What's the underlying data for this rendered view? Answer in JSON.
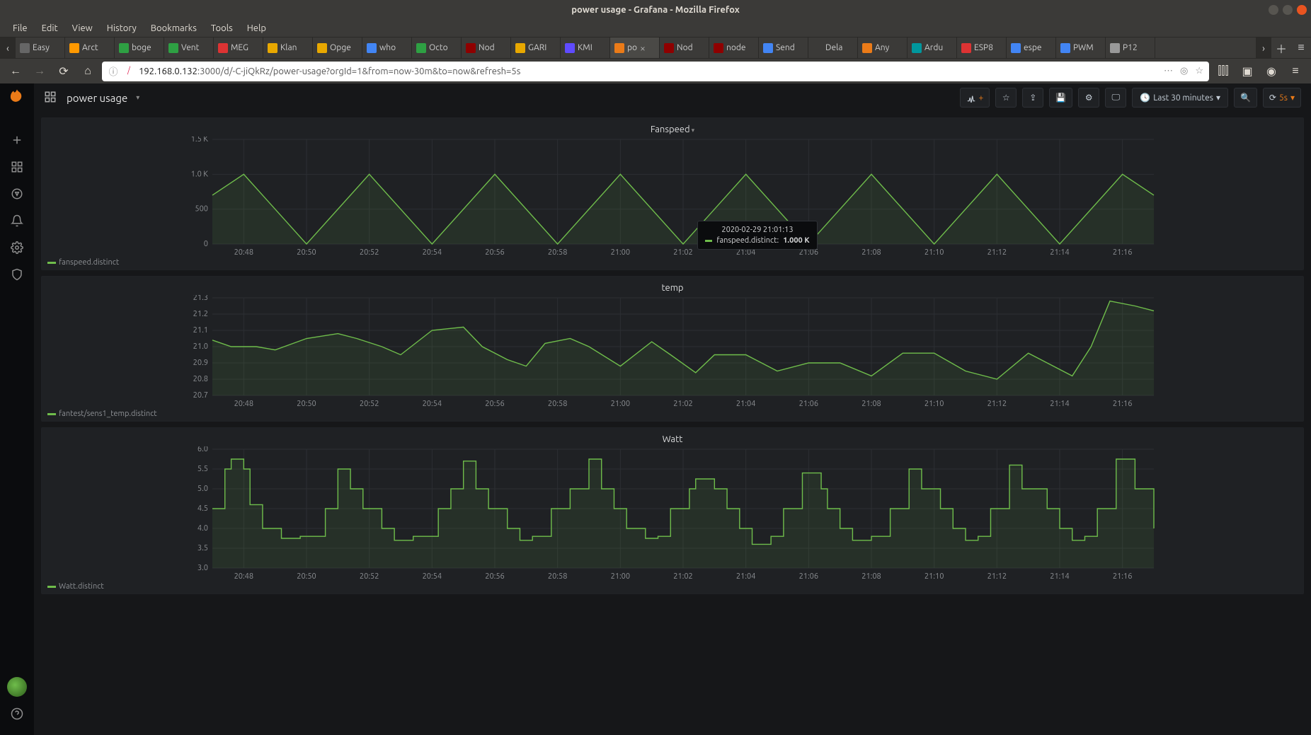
{
  "window": {
    "title": "power usage - Grafana - Mozilla Firefox"
  },
  "menubar": [
    "File",
    "Edit",
    "View",
    "History",
    "Bookmarks",
    "Tools",
    "Help"
  ],
  "tabs": [
    {
      "label": "Easy",
      "fav": "#666"
    },
    {
      "label": "Arct",
      "fav": "#ff9900"
    },
    {
      "label": "boge",
      "fav": "#2ea043"
    },
    {
      "label": "Vent",
      "fav": "#2ea043"
    },
    {
      "label": "MEG",
      "fav": "#d33"
    },
    {
      "label": "Klan",
      "fav": "#e8a800"
    },
    {
      "label": "Opge",
      "fav": "#e8a800"
    },
    {
      "label": "who",
      "fav": "#4285f4"
    },
    {
      "label": "Octo",
      "fav": "#2ea043"
    },
    {
      "label": "Nod",
      "fav": "#8f0000"
    },
    {
      "label": "GARI",
      "fav": "#e8a800"
    },
    {
      "label": "KMI",
      "fav": "#5f4bff"
    },
    {
      "label": "po",
      "fav": "#eb7b18",
      "active": true,
      "close": true
    },
    {
      "label": "Nod",
      "fav": "#8f0000"
    },
    {
      "label": "node",
      "fav": "#8f0000"
    },
    {
      "label": "Send",
      "fav": "#4285f4"
    },
    {
      "label": "Dela",
      "fav": "transparent"
    },
    {
      "label": "Any",
      "fav": "#eb7b18"
    },
    {
      "label": "Ardu",
      "fav": "#00979d"
    },
    {
      "label": "ESP8",
      "fav": "#d33"
    },
    {
      "label": "espe",
      "fav": "#4285f4"
    },
    {
      "label": "PWM",
      "fav": "#4285f4"
    },
    {
      "label": "P12",
      "fav": "#999"
    }
  ],
  "address": {
    "shield": "🛡",
    "lock": "⚠",
    "host": "192.168.0.132",
    "rest": ":3000/d/-C-jiQkRz/power-usage?orgId=1&from=now-30m&to=now&refresh=5s"
  },
  "grafana": {
    "dashboard_title": "power usage",
    "toolbar": {
      "time_label": "Last 30 minutes",
      "refresh_label": "5s"
    },
    "tooltip": {
      "time": "2020-02-29 21:01:13",
      "series": "fanspeed.distinct:",
      "value": "1.000 K"
    },
    "panels": [
      {
        "title": "Fanspeed",
        "legend": "fanspeed.distinct",
        "caret": true
      },
      {
        "title": "temp",
        "legend": "fantest/sens1_temp.distinct",
        "caret": false
      },
      {
        "title": "Watt",
        "legend": "Watt.distinct",
        "caret": false
      }
    ]
  },
  "chart_data": [
    {
      "type": "line",
      "title": "Fanspeed",
      "x_ticks": [
        "20:48",
        "20:50",
        "20:52",
        "20:54",
        "20:56",
        "20:58",
        "21:00",
        "21:02",
        "21:04",
        "21:06",
        "21:08",
        "21:10",
        "21:12",
        "21:14",
        "21:16"
      ],
      "y_ticks": [
        0,
        500,
        1000,
        1500
      ],
      "y_tick_labels": [
        "0",
        "500",
        "1.0 K",
        "1.5 K"
      ],
      "ylim": [
        0,
        1500
      ],
      "series": [
        {
          "name": "fanspeed.distinct",
          "x": [
            0,
            0.5,
            1.5,
            2.5,
            3.5,
            4.5,
            5.5,
            6.5,
            7.5,
            8.5,
            9.5,
            10.5,
            11.5,
            12.5,
            13.5,
            14.5,
            15
          ],
          "values": [
            700,
            1000,
            0,
            1000,
            0,
            1000,
            0,
            1000,
            0,
            1000,
            0,
            1000,
            0,
            1000,
            0,
            1000,
            700
          ]
        }
      ]
    },
    {
      "type": "line",
      "title": "temp",
      "x_ticks": [
        "20:48",
        "20:50",
        "20:52",
        "20:54",
        "20:56",
        "20:58",
        "21:00",
        "21:02",
        "21:04",
        "21:06",
        "21:08",
        "21:10",
        "21:12",
        "21:14",
        "21:16"
      ],
      "y_ticks": [
        20.7,
        20.8,
        20.9,
        21.0,
        21.1,
        21.2,
        21.3
      ],
      "y_tick_labels": [
        "20.7",
        "20.8",
        "20.9",
        "21.0",
        "21.1",
        "21.2",
        "21.3"
      ],
      "ylim": [
        20.7,
        21.3
      ],
      "series": [
        {
          "name": "fantest/sens1_temp.distinct",
          "x": [
            0,
            0.3,
            0.7,
            1,
            1.5,
            2,
            2.3,
            2.7,
            3,
            3.5,
            4,
            4.3,
            4.7,
            5,
            5.3,
            5.7,
            6,
            6.5,
            7,
            7.3,
            7.7,
            8,
            8.5,
            9,
            9.5,
            10,
            10.5,
            11,
            11.5,
            12,
            12.5,
            13,
            13.3,
            13.7,
            14,
            14.3,
            14.7,
            15
          ],
          "values": [
            21.04,
            21.0,
            21.0,
            20.98,
            21.05,
            21.08,
            21.05,
            21.0,
            20.95,
            21.1,
            21.12,
            21.0,
            20.92,
            20.88,
            21.02,
            21.05,
            21.0,
            20.88,
            21.03,
            20.95,
            20.84,
            20.95,
            20.95,
            20.85,
            20.9,
            20.9,
            20.82,
            20.96,
            20.96,
            20.85,
            20.8,
            20.96,
            20.9,
            20.82,
            21.0,
            21.28,
            21.25,
            21.22
          ]
        }
      ]
    },
    {
      "type": "line",
      "title": "Watt",
      "x_ticks": [
        "20:48",
        "20:50",
        "20:52",
        "20:54",
        "20:56",
        "20:58",
        "21:00",
        "21:02",
        "21:04",
        "21:06",
        "21:08",
        "21:10",
        "21:12",
        "21:14",
        "21:16"
      ],
      "y_ticks": [
        3.0,
        3.5,
        4.0,
        4.5,
        5.0,
        5.5,
        6.0
      ],
      "y_tick_labels": [
        "3.0",
        "3.5",
        "4.0",
        "4.5",
        "5.0",
        "5.5",
        "6.0"
      ],
      "ylim": [
        3.0,
        6.0
      ],
      "step": true,
      "series": [
        {
          "name": "Watt.distinct",
          "x": [
            0,
            0.2,
            0.3,
            0.5,
            0.6,
            0.8,
            1.1,
            1.4,
            1.8,
            2.0,
            2.2,
            2.4,
            2.7,
            2.9,
            3.2,
            3.6,
            3.8,
            4.0,
            4.2,
            4.4,
            4.7,
            4.9,
            5.1,
            5.4,
            5.7,
            6.0,
            6.2,
            6.4,
            6.6,
            6.9,
            7.1,
            7.3,
            7.6,
            7.7,
            8.0,
            8.2,
            8.4,
            8.6,
            8.9,
            9.1,
            9.4,
            9.7,
            9.8,
            10.0,
            10.2,
            10.5,
            10.8,
            11.1,
            11.3,
            11.6,
            11.8,
            12.0,
            12.2,
            12.4,
            12.7,
            12.9,
            13.3,
            13.5,
            13.7,
            13.9,
            14.1,
            14.4,
            14.7,
            15
          ],
          "values": [
            4.5,
            5.5,
            5.75,
            5.5,
            4.6,
            4.0,
            3.75,
            3.8,
            4.5,
            5.5,
            5.0,
            4.5,
            4.0,
            3.7,
            3.8,
            4.5,
            5.0,
            5.7,
            5.0,
            4.5,
            4.0,
            3.7,
            3.8,
            4.5,
            5.0,
            5.75,
            5.0,
            4.5,
            4.0,
            3.75,
            3.8,
            4.5,
            5.0,
            5.25,
            5.0,
            4.5,
            4.0,
            3.6,
            3.8,
            4.5,
            5.4,
            5.0,
            4.5,
            4.0,
            3.7,
            3.8,
            4.5,
            5.5,
            5.0,
            4.5,
            4.0,
            3.7,
            3.8,
            4.5,
            5.6,
            5.0,
            4.5,
            4.0,
            3.7,
            3.8,
            4.5,
            5.75,
            5.0,
            4.0
          ]
        }
      ]
    }
  ]
}
